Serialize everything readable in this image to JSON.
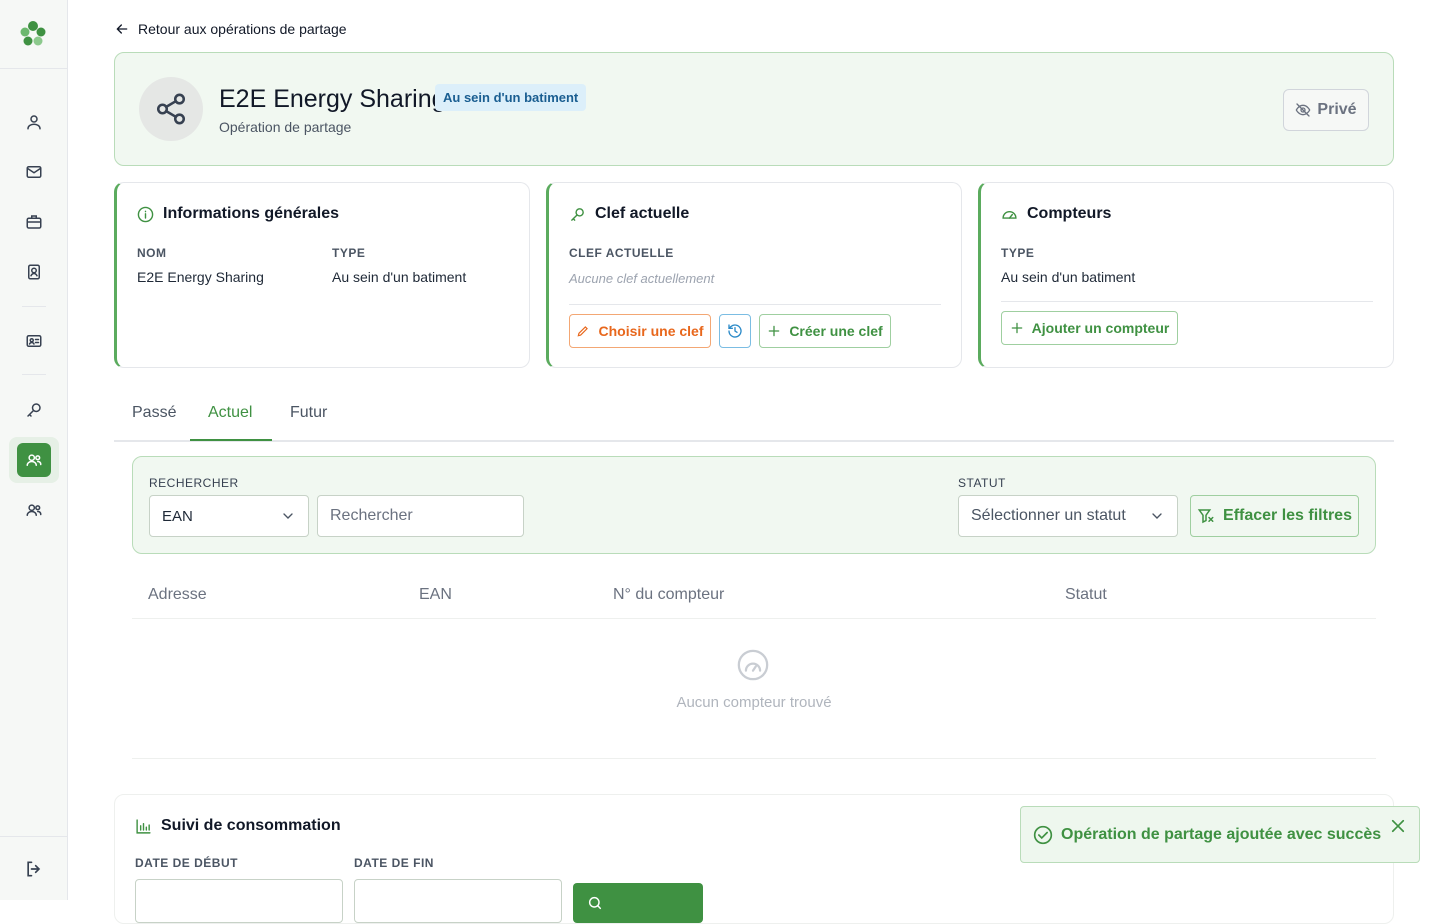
{
  "brand": {
    "accent": "#3f9142",
    "info_badge_bg": "#dceffa",
    "warning": "#e8671c"
  },
  "sidebar": {
    "items": [
      {
        "icon": "user-icon"
      },
      {
        "icon": "mail-icon"
      },
      {
        "icon": "briefcase-icon"
      },
      {
        "icon": "contact-book-icon"
      },
      {
        "icon": "id-card-icon"
      },
      {
        "icon": "key-icon"
      },
      {
        "icon": "users-icon",
        "active": true
      },
      {
        "icon": "users-outline-icon"
      }
    ],
    "logout_icon": "logout-icon"
  },
  "back_link": {
    "label": "Retour aux opérations de partage"
  },
  "header": {
    "title": "E2E Energy Sharing",
    "badge": "Au sein d'un batiment",
    "subtitle": "Opération de partage",
    "visibility_label": "Privé"
  },
  "cards": {
    "general": {
      "title": "Informations générales",
      "nom_label": "NOM",
      "nom_value": "E2E Energy Sharing",
      "type_label": "TYPE",
      "type_value": "Au sein d'un batiment"
    },
    "key": {
      "title": "Clef actuelle",
      "label": "CLEF ACTUELLE",
      "empty_value": "Aucune clef actuellement",
      "choose_label": "Choisir une clef",
      "create_label": "Créer une clef"
    },
    "meters": {
      "title": "Compteurs",
      "type_label": "TYPE",
      "type_value": "Au sein d'un batiment",
      "add_label": "Ajouter un compteur"
    }
  },
  "tabs": [
    {
      "label": "Passé",
      "active": false
    },
    {
      "label": "Actuel",
      "active": true
    },
    {
      "label": "Futur",
      "active": false
    }
  ],
  "filters": {
    "search_label": "RECHERCHER",
    "search_field_value": "EAN",
    "search_placeholder": "Rechercher",
    "status_label": "STATUT",
    "status_placeholder": "Sélectionner un statut",
    "clear_label": "Effacer les filtres"
  },
  "table": {
    "columns": [
      "Adresse",
      "EAN",
      "N° du compteur",
      "Statut"
    ],
    "empty_text": "Aucun compteur trouvé"
  },
  "consumption": {
    "title": "Suivi de consommation",
    "start_label": "DATE DE DÉBUT",
    "end_label": "DATE DE FIN"
  },
  "toast": {
    "message": "Opération de partage ajoutée avec succès"
  }
}
